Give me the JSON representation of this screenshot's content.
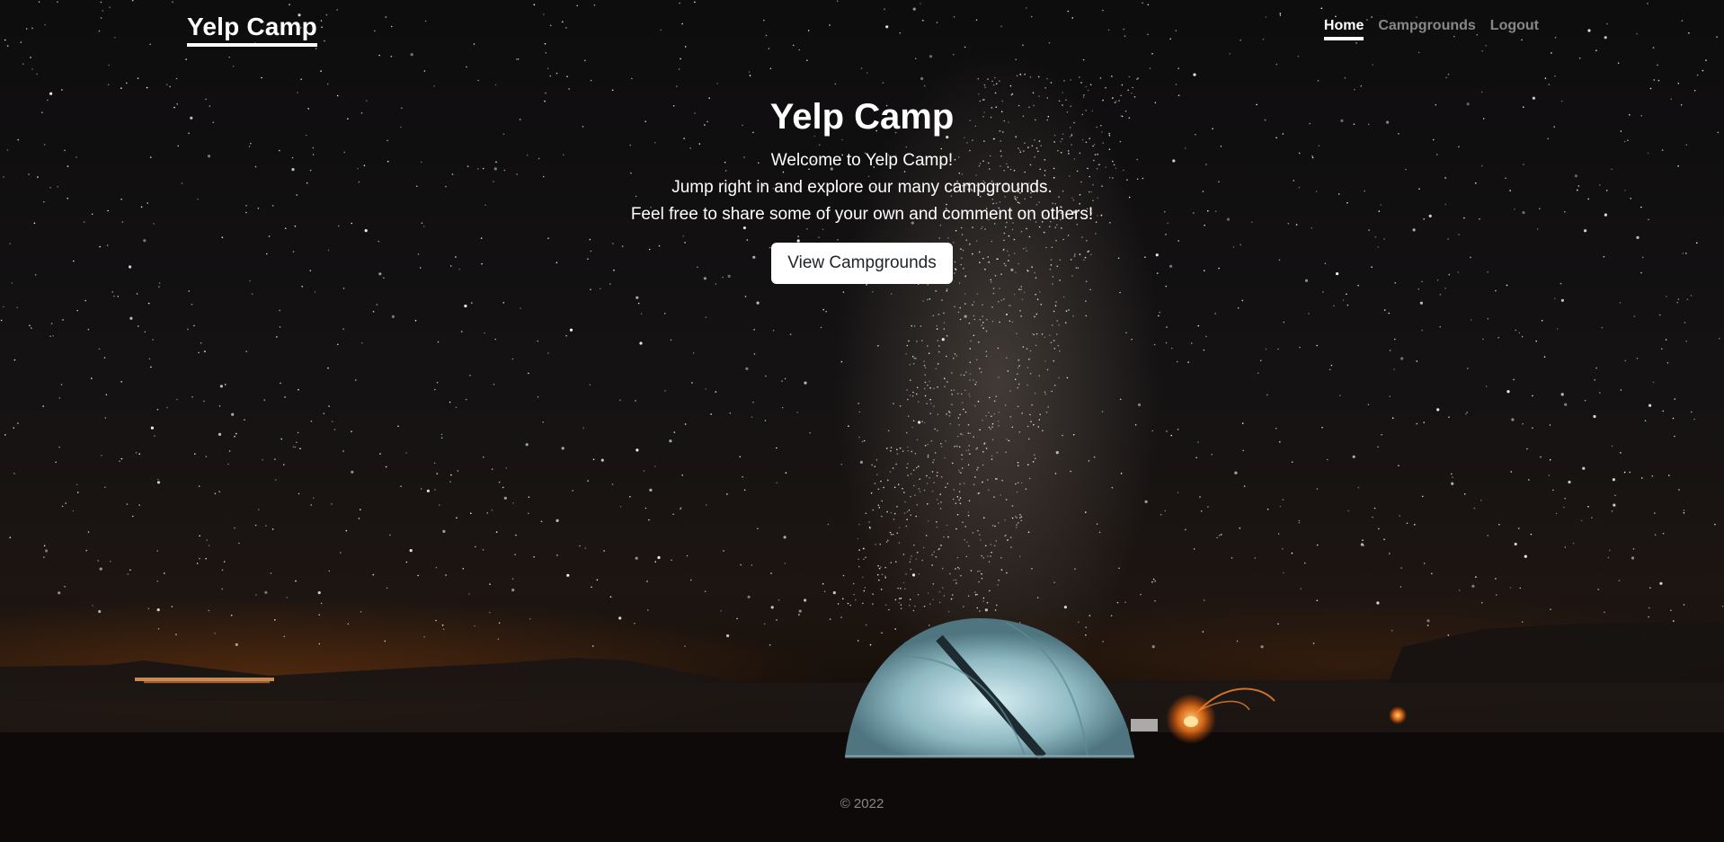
{
  "navbar": {
    "brand": "Yelp Camp",
    "links": [
      {
        "label": "Home",
        "active": true
      },
      {
        "label": "Campgrounds",
        "active": false
      },
      {
        "label": "Logout",
        "active": false
      }
    ]
  },
  "hero": {
    "title": "Yelp Camp",
    "lines": [
      "Welcome to Yelp Camp!",
      "Jump right in and explore our many campgrounds.",
      "Feel free to share some of your own and comment on others!"
    ],
    "button_label": "View Campgrounds"
  },
  "footer": {
    "text": "© 2022"
  },
  "colors": {
    "text": "#ffffff",
    "muted_text": "rgba(255,255,255,0.5)",
    "button_bg": "#ffffff",
    "button_text": "#212529",
    "tent": "#9cc3cc"
  }
}
